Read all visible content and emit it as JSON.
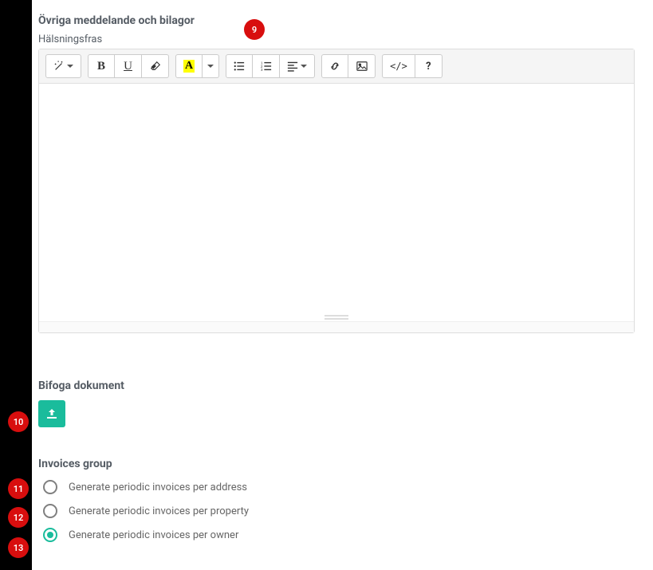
{
  "badges": {
    "b9": "9",
    "b10": "10",
    "b11": "11",
    "b12": "12",
    "b13": "13"
  },
  "section_messages": {
    "heading": "Övriga meddelande och bilagor",
    "greeting_label": "Hälsningsfras"
  },
  "toolbar": {
    "bold_glyph": "B",
    "underline_glyph": "U",
    "color_glyph": "A",
    "code_glyph": "</>",
    "help_glyph": "?"
  },
  "attach": {
    "heading": "Bifoga dokument"
  },
  "invoices": {
    "heading": "Invoices group",
    "options": [
      {
        "label": "Generate periodic invoices per address",
        "selected": false
      },
      {
        "label": "Generate periodic invoices per property",
        "selected": false
      },
      {
        "label": "Generate periodic invoices per owner",
        "selected": true
      }
    ]
  }
}
